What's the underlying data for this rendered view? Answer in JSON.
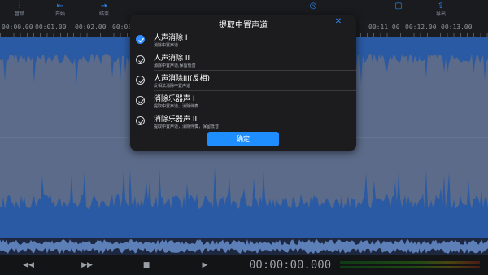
{
  "toolbar": {
    "tools": [
      {
        "label": "音频",
        "icon": "levels-icon"
      },
      {
        "label": "开始",
        "icon": "begin-icon"
      },
      {
        "label": "结束",
        "icon": "end-icon"
      },
      {
        "label": "",
        "icon": "tool-icon"
      },
      {
        "label": "",
        "icon": "tool-icon"
      },
      {
        "label": "",
        "icon": "tool-icon"
      },
      {
        "label": "",
        "icon": "tool-icon"
      },
      {
        "label": "",
        "icon": "tool-icon"
      },
      {
        "label": "",
        "icon": "tool-icon"
      },
      {
        "label": "",
        "icon": "tool-icon"
      },
      {
        "label": "",
        "icon": "tool-icon"
      },
      {
        "label": "导出",
        "icon": "export-icon"
      }
    ]
  },
  "ruler": {
    "ticks": [
      "00:00.00",
      "00:01.00",
      "00:02.00",
      "00:03.00",
      "00:11.00",
      "00:12.00",
      "00:13.00"
    ]
  },
  "dialog": {
    "title": "提取中置声道",
    "options": [
      {
        "name": "人声消除 I",
        "desc": "消除中置声道",
        "checked": true
      },
      {
        "name": "人声消除 II",
        "desc": "消除中置声道,保留低音",
        "checked": false
      },
      {
        "name": "人声消除III(反相)",
        "desc": "反相法消除中置声道",
        "checked": false
      },
      {
        "name": "消除乐器声 I",
        "desc": "提取中置声道，消除伴奏",
        "checked": false
      },
      {
        "name": "消除乐器声 II",
        "desc": "提取中置声道，消除伴奏，保留低音",
        "checked": false
      }
    ],
    "confirm_label": "确定"
  },
  "transport": {
    "timecode": "00:00:00.000"
  },
  "colors": {
    "accent": "#2f8cff",
    "waveform": "#2a5aa3",
    "waveform_bg": "#5b6b89"
  }
}
